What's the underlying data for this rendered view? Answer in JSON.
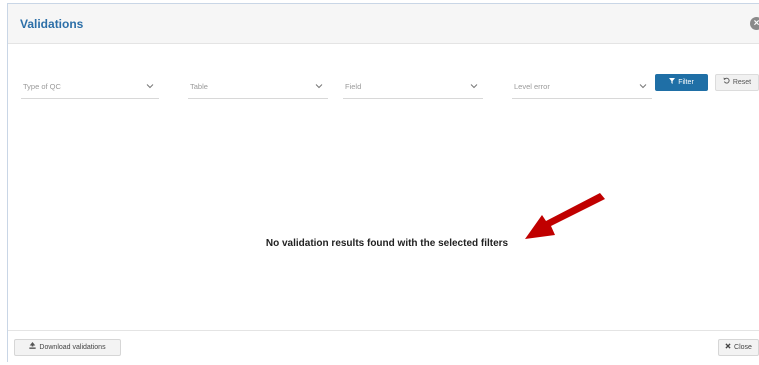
{
  "dialog": {
    "title": "Validations",
    "close_glyph": "×"
  },
  "filters": {
    "type_of_qc": {
      "placeholder": "Type of QC"
    },
    "table": {
      "placeholder": "Table"
    },
    "field": {
      "placeholder": "Field"
    },
    "level_error": {
      "placeholder": "Level error"
    },
    "filter_label": "Filter",
    "reset_label": "Reset",
    "filter_icon": "filter-icon",
    "reset_icon": "undo-icon"
  },
  "results": {
    "empty_message": "No validation results found with the selected filters"
  },
  "annotation": {
    "arrow_color": "#c00000"
  },
  "footer": {
    "download_label": "Download validations",
    "download_icon": "download-icon",
    "close_label": "Close",
    "close_icon": "times-icon"
  },
  "colors": {
    "accent": "#1f6fa6",
    "title": "#2c6fa8"
  }
}
